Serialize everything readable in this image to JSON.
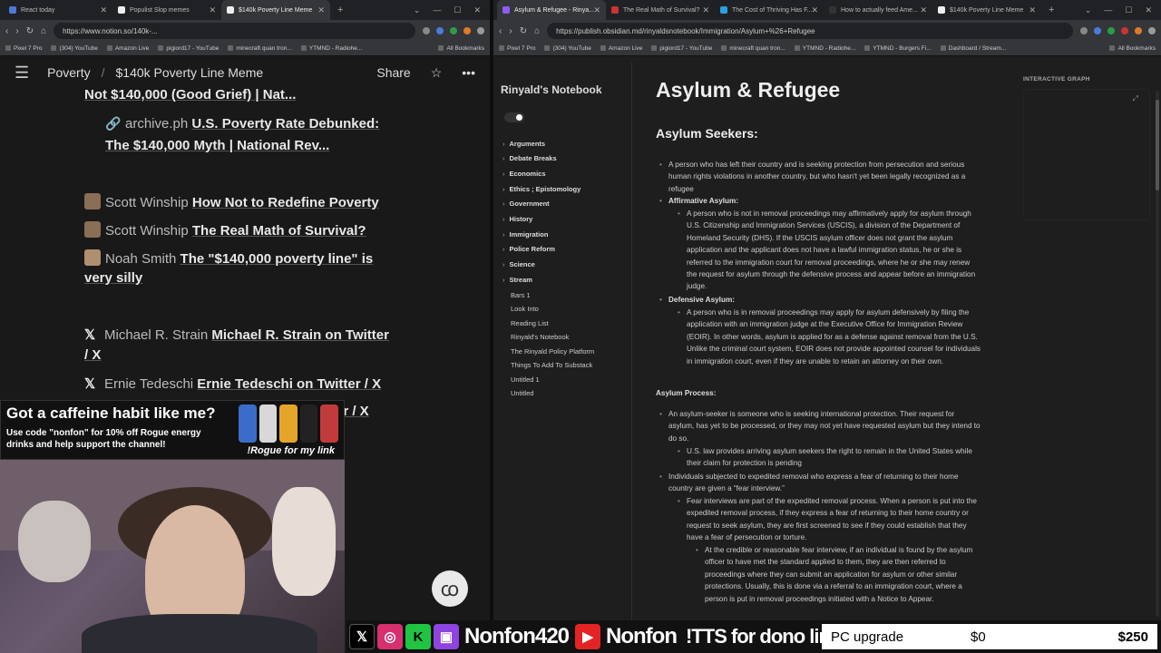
{
  "left_browser": {
    "tabs": [
      {
        "label": "React today",
        "color": "#4b7bd6"
      },
      {
        "label": "Populist Slop memes",
        "color": "#eee"
      },
      {
        "label": "$140k Poverty Line Meme",
        "color": "#eee",
        "active": true
      }
    ],
    "url": "https://www.notion.so/140k-..."
  },
  "right_browser": {
    "tabs": [
      {
        "label": "Asylum & Refugee - Rinya...",
        "color": "#8e5cf7",
        "active": true
      },
      {
        "label": "The Real Math of Survival?",
        "color": "#c33"
      },
      {
        "label": "The Cost of Thriving Has F...",
        "color": "#2aa0e0"
      },
      {
        "label": "How to actually feed Ame...",
        "color": "#333"
      },
      {
        "label": "$140k Poverty Line Meme",
        "color": "#eee"
      }
    ],
    "url": "https://publish.obsidian.md/rinyaldsnotebook/Immigration/Asylum+%26+Refugee"
  },
  "bookmarks": [
    "Pixel 7 Pro",
    "(304) YouTube",
    "Amazon Live",
    "pigiord17 - YouTube",
    "minecraft quan tron...",
    "YTMND - Radiohe..."
  ],
  "bookmarks_right": [
    "Pixel 7 Pro",
    "(304) YouTube",
    "Amazon Live",
    "pigiord17 - YouTube",
    "minecraft quan tron...",
    "YTMND - Radiohe...",
    "YTMND - Burgers Fi...",
    "Dashboard / Stream..."
  ],
  "all_bookmarks": "All Bookmarks",
  "notion": {
    "breadcrumb_root": "Poverty",
    "breadcrumb_page": "$140k Poverty Line Meme",
    "share": "Share",
    "lines": {
      "l0": "Not $140,000 (Good Grief) | Nat...",
      "l1_prefix": "archive.ph",
      "l1_link": "U.S. Poverty Rate Debunked:",
      "l1b": "The $140,000 Myth | National Rev...",
      "l2_author": "Scott Winship",
      "l2_link": "How Not to Redefine Poverty",
      "l3_author": "Scott Winship",
      "l3_link": "The Real Math of Survival?",
      "l4_author": "Noah Smith",
      "l4_link": "The \"$140,000 poverty line\" is",
      "l4b": "very silly",
      "l5_author": "Michael R. Strain",
      "l5_link": "Michael R. Strain on Twitter",
      "l5b": "/ X",
      "l6_author": "Ernie Tedeschi",
      "l6_link": "Ernie Tedeschi on Twitter / X",
      "l7_tail": "er / X"
    }
  },
  "ad": {
    "line1": "Got a caffeine habit like me?",
    "line2": "Use code \"nonfon\" for 10% off Rogue energy drinks and help support the channel!",
    "tag": "!Rogue for my link"
  },
  "obsidian": {
    "site_name": "Rinyald's Notebook",
    "folders": [
      "Arguments",
      "Debate Breaks",
      "Economics",
      "Ethics ; Epistomology",
      "Government",
      "History",
      "Immigration",
      "Police Reform",
      "Science",
      "Stream"
    ],
    "notes": [
      "Bars 1",
      "Look Into",
      "Reading List",
      "Rinyald's Notebook",
      "The Rinyald Policy Platform",
      "Things To Add To Substack",
      "Untitled 1",
      "Untitled"
    ],
    "title": "Asylum & Refugee",
    "h2": "Asylum Seekers:",
    "graph_label": "INTERACTIVE GRAPH",
    "p1": "A person who has left their country and is seeking protection from persecution and serious human rights violations in another country, but who hasn't yet been legally recognized as a refugee",
    "aff_title": "Affirmative Asylum:",
    "aff": "A person who is not in removal proceedings may affirmatively apply for asylum through U.S. Citizenship and Immigration Services (USCIS), a division of the Department of Homeland Security (DHS). If the USCIS asylum officer does not grant the asylum application and the applicant does not have a lawful immigration status, he or she is referred to the immigration court for removal proceedings, where he or she may renew the request for asylum through the defensive process and appear before an immigration judge.",
    "def_title": "Defensive Asylum:",
    "def": "A person who is in removal proceedings may apply for asylum defensively by filing the application with an immigration judge at the Executive Office for Immigration Review (EOIR). In other words, asylum is applied for as a defense against removal from the U.S. Unlike the criminal court system, EOIR does not provide appointed counsel for individuals in immigration court, even if they are unable to retain an attorney on their own.",
    "process_title": "Asylum Process:",
    "proc1": "An asylum-seeker is someone who is seeking international protection. Their request for asylum, has yet to be processed, or they may not yet have requested asylum but they intend to do so.",
    "proc1a": "U.S. law provides arriving asylum seekers the right to remain in the United States while their claim for protection is pending",
    "proc2": "Individuals subjected to expedited removal who express a fear of returning to their home country are given a “fear interview.”",
    "proc2a": "Fear interviews are part of the expedited removal process. When a person is put into the expedited removal process, if they express a fear of returning to their home country or request to seek asylum, they are first screened to see if they could establish that they have a fear of persecution or torture.",
    "proc2b": "At the credible or reasonable fear interview, if an individual is found by the asylum officer to have met the standard applied to them, they are then referred to proceedings where they can submit an application for asylum or other similar protections. Usually, this is done via a referral to an immigration court, where a person is put in removal proceedings initiated with a Notice to Appear."
  },
  "banner": {
    "handle1": "Nonfon420",
    "handle2": "Nonfon",
    "tts": "!TTS for dono link",
    "goal_label": "PC upgrade",
    "goal_current": "$0",
    "goal_target": "$250",
    "goal_progress": 0
  }
}
